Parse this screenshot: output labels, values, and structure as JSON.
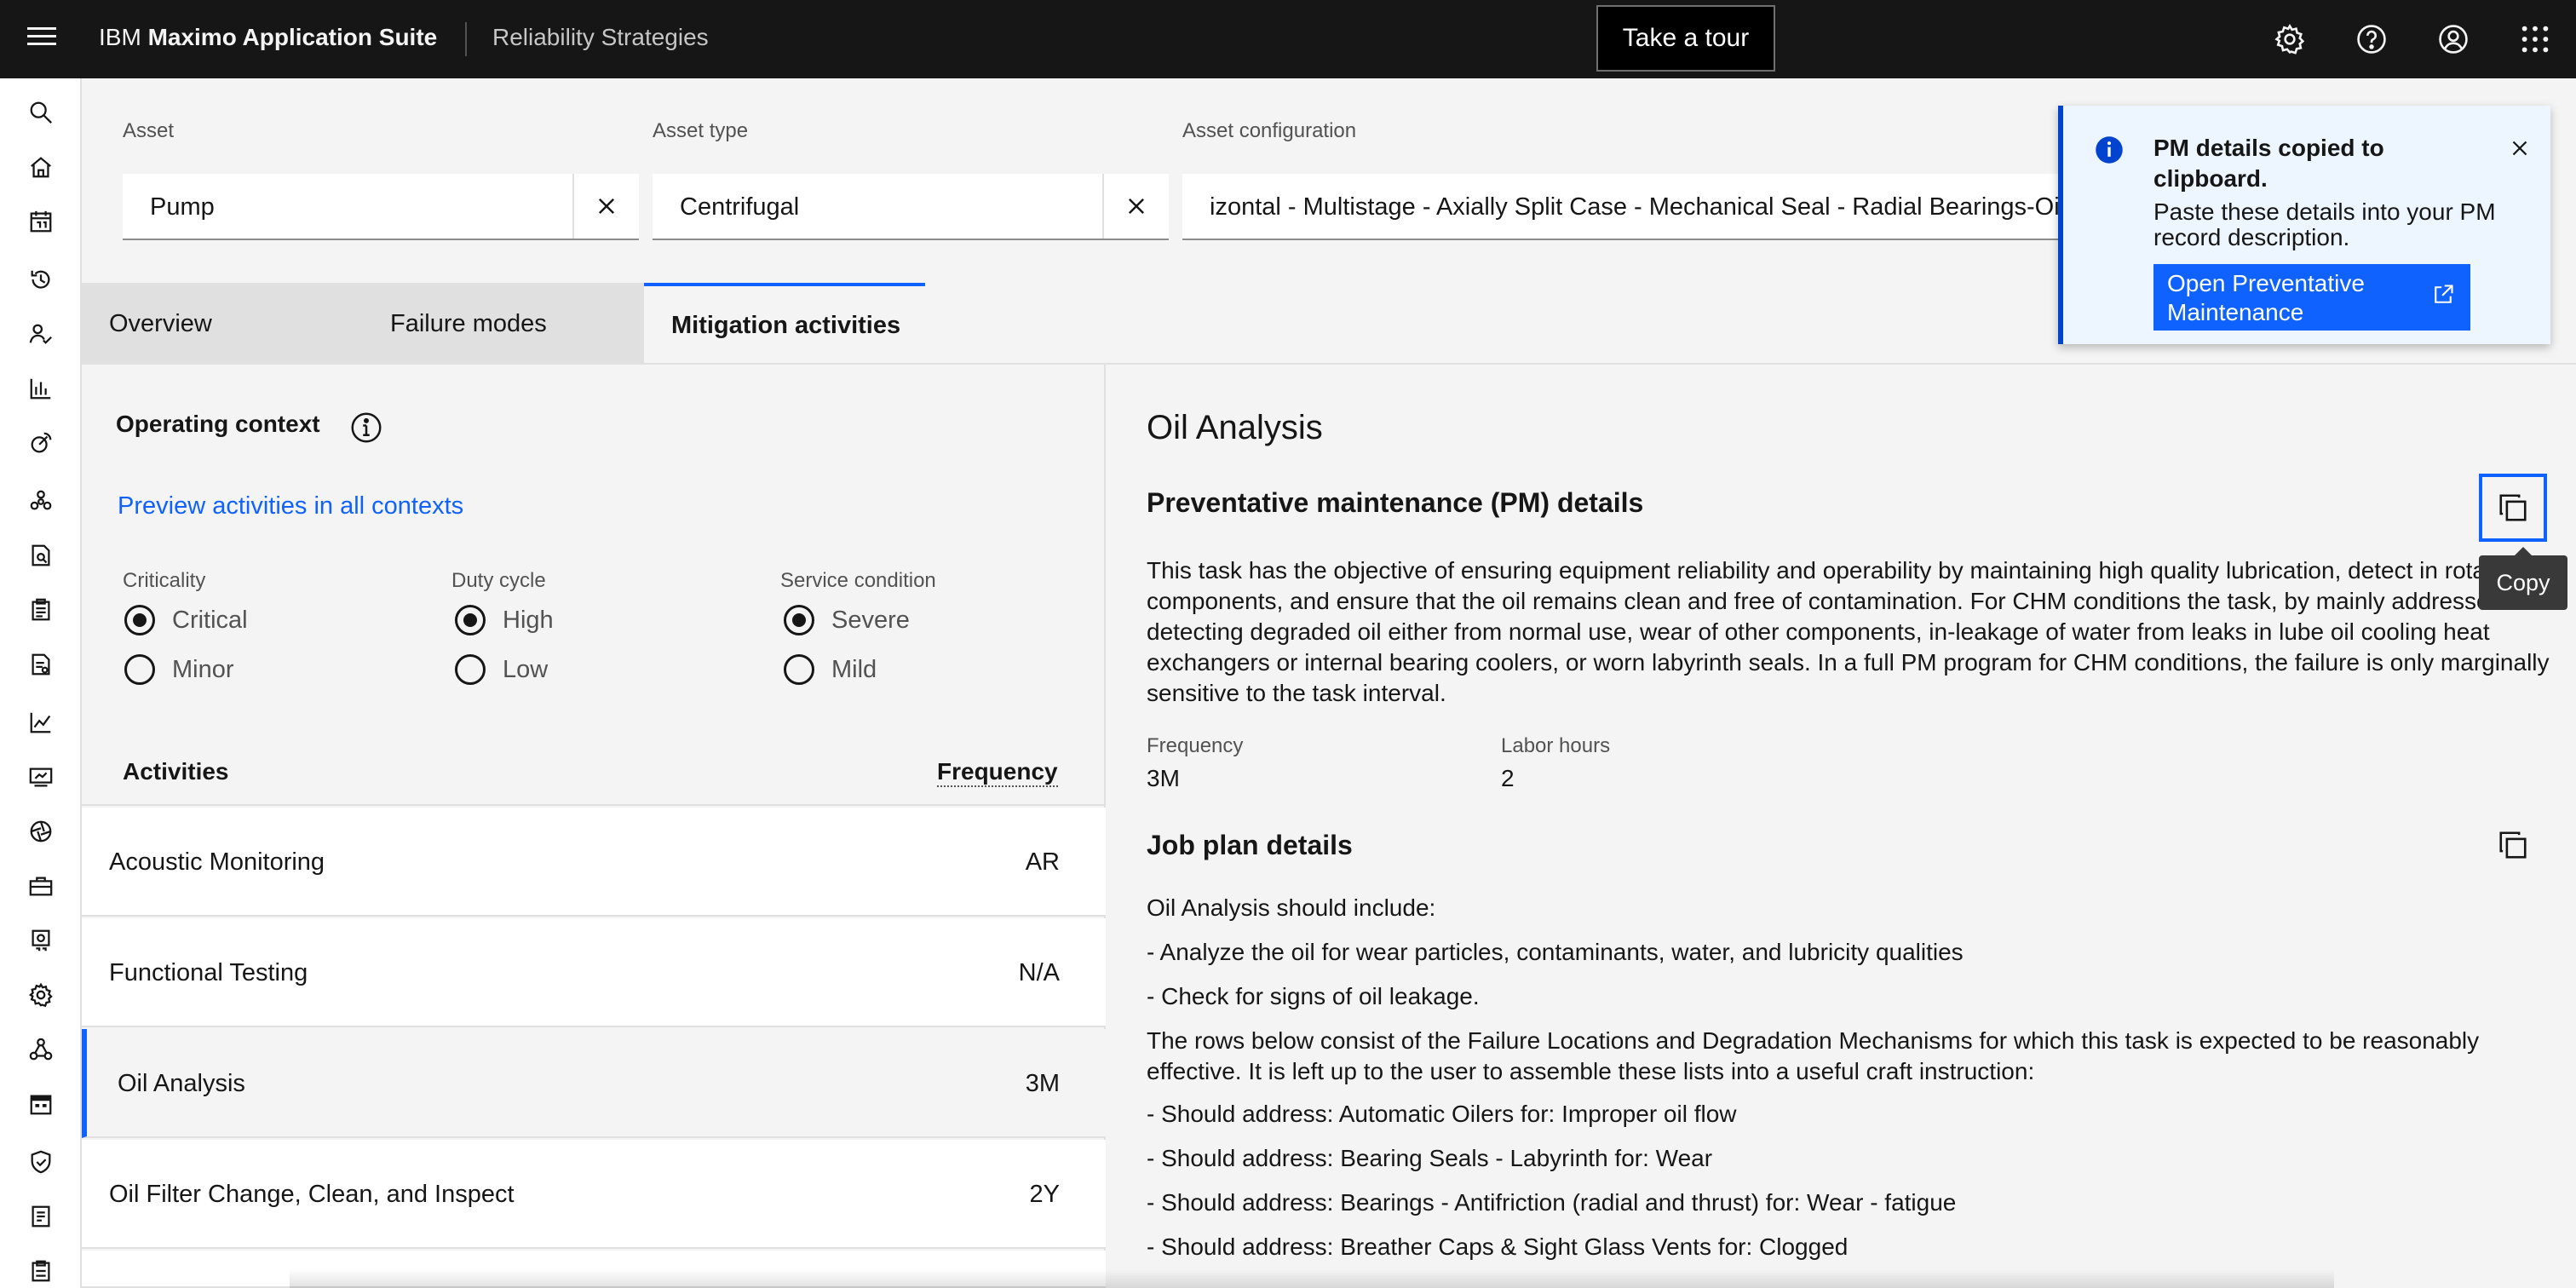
{
  "header": {
    "brand_light": "IBM",
    "brand_bold": "Maximo Application Suite",
    "product": "Reliability Strategies",
    "tour_label": "Take a tour",
    "icons": [
      "settings-icon",
      "help-icon",
      "user-icon",
      "app-switcher-icon"
    ]
  },
  "sidenav": {
    "icons": [
      "search-icon",
      "home-icon",
      "calendar-icon",
      "history-icon",
      "user-check-icon",
      "bar-chart-icon",
      "satellite-icon",
      "network-icon",
      "document-search-icon",
      "clipboard-icon",
      "report-icon",
      "line-chart-icon",
      "monitor-icon",
      "aperture-icon",
      "toolbox-icon",
      "machine-icon",
      "settings-icon",
      "nodes-icon",
      "calendar-grid-icon",
      "shield-check-icon",
      "notebook-icon",
      "inventory-icon"
    ]
  },
  "filters": {
    "asset_label": "Asset",
    "asset_value": "Pump",
    "type_label": "Asset type",
    "type_value": "Centrifugal",
    "config_label": "Asset configuration",
    "config_value": "izontal - Multistage - Axially Split Case - Mechanical Seal - Radial Bearings-Oil"
  },
  "tabs": [
    {
      "label": "Overview",
      "active": false
    },
    {
      "label": "Failure modes",
      "active": false
    },
    {
      "label": "Mitigation activities",
      "active": true
    }
  ],
  "operating_context": {
    "title": "Operating context",
    "preview_link": "Preview activities in all contexts",
    "groups": [
      {
        "label": "Criticality",
        "options": [
          {
            "label": "Critical",
            "selected": true
          },
          {
            "label": "Minor",
            "selected": false
          }
        ]
      },
      {
        "label": "Duty cycle",
        "options": [
          {
            "label": "High",
            "selected": true
          },
          {
            "label": "Low",
            "selected": false
          }
        ]
      },
      {
        "label": "Service condition",
        "options": [
          {
            "label": "Severe",
            "selected": true
          },
          {
            "label": "Mild",
            "selected": false
          }
        ]
      }
    ]
  },
  "activities": {
    "col_activities": "Activities",
    "col_frequency": "Frequency",
    "rows": [
      {
        "name": "Acoustic Monitoring",
        "frequency": "AR"
      },
      {
        "name": "Functional Testing",
        "frequency": "N/A"
      },
      {
        "name": "Oil Analysis",
        "frequency": "3M",
        "selected": true
      },
      {
        "name": "Oil Filter Change, Clean, and Inspect",
        "frequency": "2Y"
      }
    ]
  },
  "detail": {
    "title": "Oil Analysis",
    "pm_heading": "Preventative maintenance (PM) details",
    "pm_description": "This task has the objective of ensuring equipment reliability and operability by maintaining high quality lubrication, detect in rotating components, and ensure that the oil remains clean and free of contamination. For CHM conditions the task, by mainly addresses detecting degraded oil either from normal use, wear of other components, in-leakage of water from leaks in lube oil cooling heat exchangers or internal bearing coolers, or worn labyrinth seals. In a full PM program for CHM conditions, the failure is only marginally sensitive to the task interval.",
    "frequency_label": "Frequency",
    "frequency_value": "3M",
    "labor_label": "Labor hours",
    "labor_value": "2",
    "job_heading": "Job plan details",
    "job_intro": "Oil Analysis should include:",
    "job_steps": [
      "- Analyze the oil for wear particles, contaminants, water, and lubricity qualities",
      "- Check for signs of oil leakage."
    ],
    "job_rows_intro": "The rows below consist of the Failure Locations and Degradation Mechanisms for which this task is expected to be reasonably effective. It is left up to the user to assemble these lists into a useful craft instruction:",
    "job_rows": [
      "- Should address: Automatic Oilers for: Improper oil flow",
      "- Should address: Bearing Seals - Labyrinth for: Wear",
      "- Should address: Bearings - Antifriction (radial and thrust) for: Wear - fatigue",
      "- Should address: Breather Caps & Sight Glass Vents for: Clogged"
    ],
    "copy_tooltip": "Copy"
  },
  "notification": {
    "title": "PM details copied to clipboard.",
    "body": "Paste these details into your PM record description.",
    "button": "Open Preventative Maintenance",
    "accent": "#0f62fe"
  }
}
